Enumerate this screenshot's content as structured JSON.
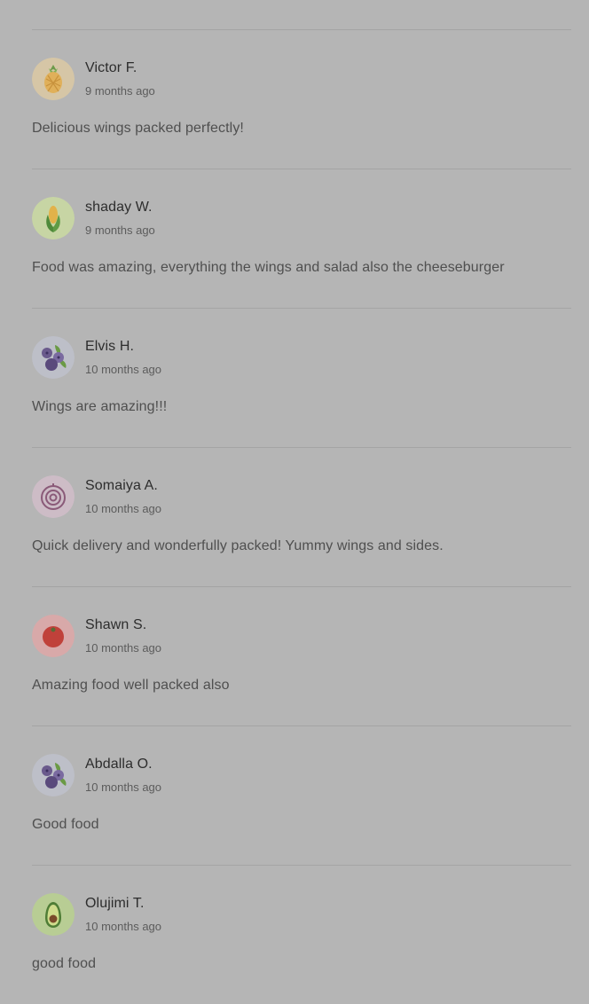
{
  "reviews": [
    {
      "name": "Victor F.",
      "time": "9 months ago",
      "text": "Delicious wings packed perfectly!",
      "avatar_icon": "pineapple-icon",
      "avatar_bg": "#d6c6a6"
    },
    {
      "name": "shaday W.",
      "time": "9 months ago",
      "text": "Food was amazing, everything the wings and salad also the cheeseburger",
      "avatar_icon": "corn-icon",
      "avatar_bg": "#c7d5a4"
    },
    {
      "name": "Elvis H.",
      "time": "10 months ago",
      "text": "Wings are amazing!!!",
      "avatar_icon": "blueberry-icon",
      "avatar_bg": "#bdbfc8"
    },
    {
      "name": "Somaiya A.",
      "time": "10 months ago",
      "text": "Quick delivery and wonderfully packed! Yummy wings and sides.",
      "avatar_icon": "onion-icon",
      "avatar_bg": "#cdbcc6"
    },
    {
      "name": "Shawn S.",
      "time": "10 months ago",
      "text": "Amazing food well packed also",
      "avatar_icon": "tomato-icon",
      "avatar_bg": "#d8a9a9"
    },
    {
      "name": "Abdalla O.",
      "time": "10 months ago",
      "text": "Good food",
      "avatar_icon": "blueberry-icon",
      "avatar_bg": "#bdbfc8"
    },
    {
      "name": "Olujimi T.",
      "time": "10 months ago",
      "text": "good food",
      "avatar_icon": "avocado-icon",
      "avatar_bg": "#b8cd94"
    }
  ],
  "colors": {
    "page_bg": "#b5b5b5",
    "divider": "#a4a4a4"
  }
}
